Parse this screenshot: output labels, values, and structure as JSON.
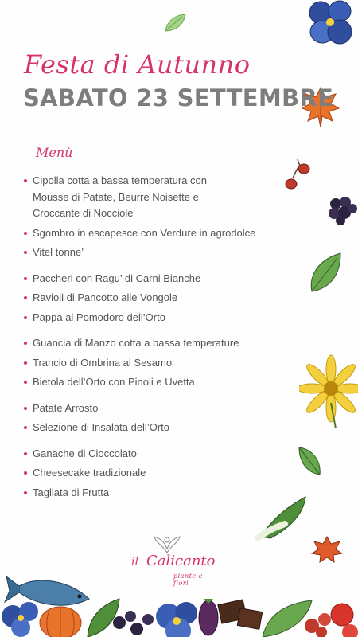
{
  "event": {
    "title": "Festa di Autunno",
    "date": "SABATO 23 SETTEMBRE"
  },
  "menu": {
    "heading": "Menù",
    "items": [
      "Cipolla cotta a bassa temperatura con",
      "Mousse di Patate, Beurre Noisette e",
      "Croccante di Nocciole",
      "Sgombro in escapesce con Verdure in agrodolce",
      "Vitel tonne’",
      "Paccheri con Ragu’ di Carni Bianche",
      "Ravioli di Pancotto alle Vongole",
      "Pappa al Pomodoro dell’Orto",
      "Guancia di Manzo cotta a bassa temperature",
      "Trancio di Ombrina al Sesamo",
      "Bietola dell’Orto con Pinoli e Uvetta",
      "Patate Arrosto",
      "Selezione di Insalata dell’Orto",
      "Ganache di Cioccolato",
      "Cheesecake tradizionale",
      "Tagliata di Frutta"
    ]
  },
  "logo": {
    "article": "il",
    "name": "Calicanto",
    "tagline": "piante e fiori"
  },
  "colors": {
    "accent": "#d6336c",
    "title_gray": "#7d7d7d",
    "text": "#555555"
  },
  "decorations": [
    "leaf-icon",
    "pansy-flower-icon",
    "autumn-leaf-icon",
    "rosehip-icon",
    "blackberry-icon",
    "green-leaf-icon",
    "sunflower-icon",
    "small-leaf-icon",
    "bok-choy-icon",
    "red-leaf-icon",
    "fish-icon",
    "vegetables-border"
  ]
}
